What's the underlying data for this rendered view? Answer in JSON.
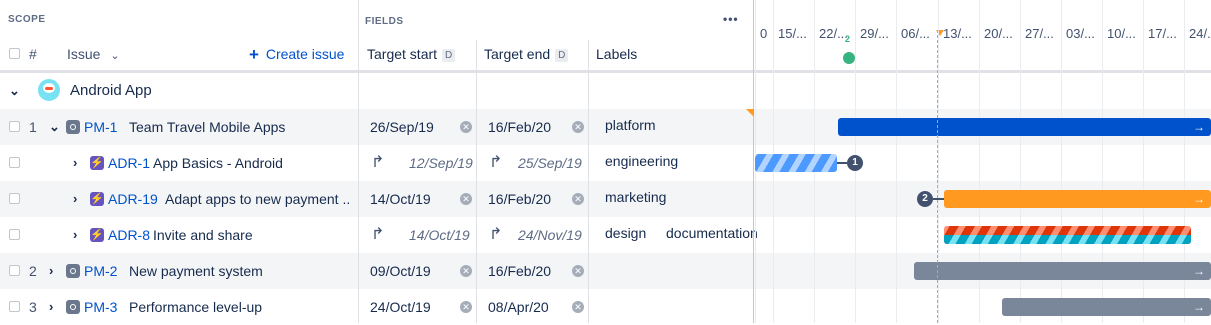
{
  "header": {
    "scope_label": "SCOPE",
    "fields_label": "FIELDS",
    "hash_label": "#",
    "issue_label": "Issue",
    "create_issue_label": "Create issue",
    "target_start_label": "Target start",
    "target_end_label": "Target end",
    "d_badge": "D",
    "labels_label": "Labels",
    "more_label": "•••"
  },
  "timeline": {
    "ticks": [
      "0",
      "15/...",
      "22/...",
      "29/...",
      "06/...",
      "13/...",
      "20/...",
      "27/...",
      "03/...",
      "10/...",
      "17/...",
      "24/..."
    ],
    "marker_count": "2"
  },
  "group": {
    "title": "Android App"
  },
  "rows": [
    {
      "num": "1",
      "key": "PM-1",
      "summary": "Team Travel Mobile Apps",
      "start": "26/Sep/19",
      "end": "16/Feb/20",
      "labels": [
        "platform"
      ],
      "bar_color": "#0052cc",
      "bar_type": "solid"
    },
    {
      "num": "",
      "key": "ADR-1",
      "summary": "App Basics - Android",
      "start": "12/Sep/19",
      "end": "25/Sep/19",
      "labels": [
        "engineering"
      ],
      "bar_color": "#4c9aff",
      "bar_type": "striped",
      "dep_count": "1"
    },
    {
      "num": "",
      "key": "ADR-19",
      "summary": "Adapt apps to new payment ...",
      "start": "14/Oct/19",
      "end": "16/Feb/20",
      "labels": [
        "marketing"
      ],
      "bar_color": "#ff991f",
      "bar_type": "solid",
      "dep_count": "2"
    },
    {
      "num": "",
      "key": "ADR-8",
      "summary": "Invite and share",
      "start": "14/Oct/19",
      "end": "24/Nov/19",
      "labels": [
        "design",
        "documentation"
      ],
      "bar_color": "#de350b",
      "bar_type": "dual-striped"
    },
    {
      "num": "2",
      "key": "PM-2",
      "summary": "New payment system",
      "start": "09/Oct/19",
      "end": "16/Feb/20",
      "labels": [],
      "bar_color": "#7a869a",
      "bar_type": "solid"
    },
    {
      "num": "3",
      "key": "PM-3",
      "summary": "Performance level-up",
      "start": "24/Oct/19",
      "end": "08/Apr/20",
      "labels": [],
      "bar_color": "#7a869a",
      "bar_type": "solid"
    }
  ]
}
